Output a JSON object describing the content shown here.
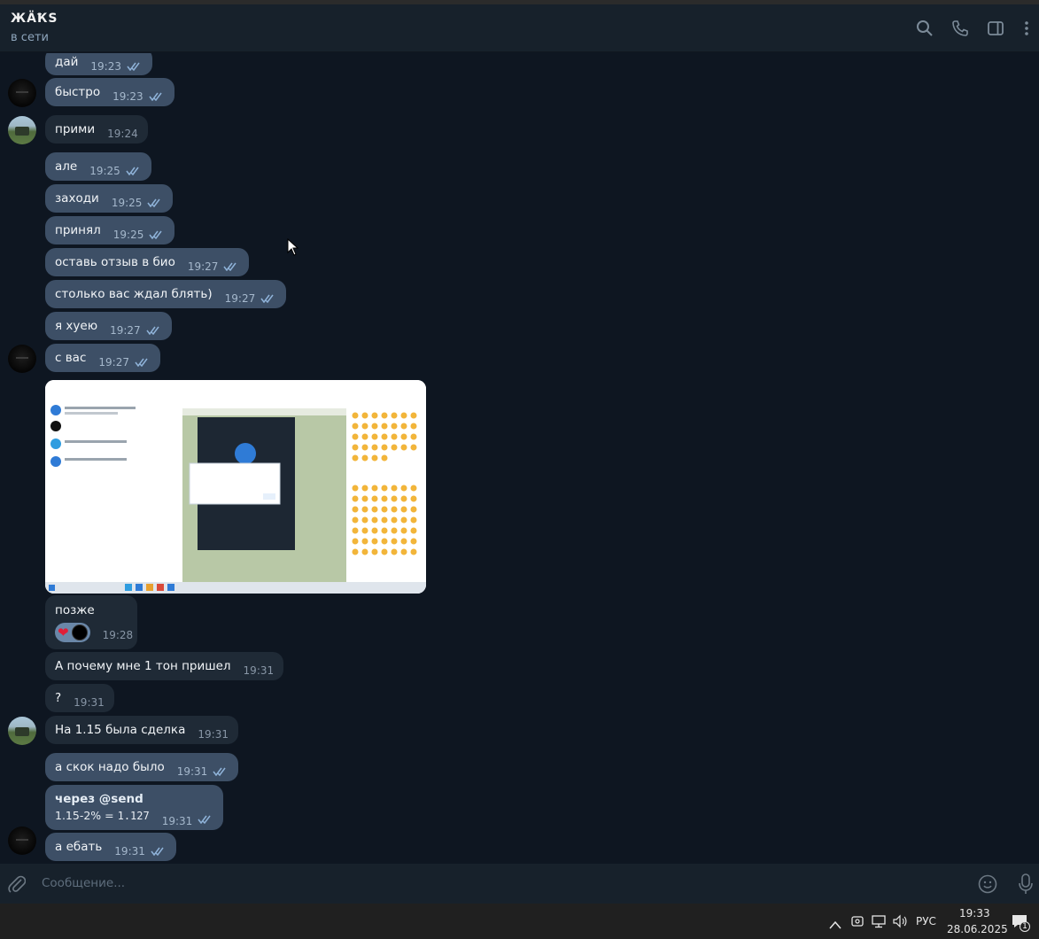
{
  "header": {
    "title": "ЖÄҞS",
    "status": "в сети"
  },
  "messages": [
    {
      "dir": "out",
      "text": "дай",
      "time": "19:23"
    },
    {
      "dir": "out",
      "text": "быстро",
      "time": "19:23"
    },
    {
      "dir": "in",
      "text": "прими",
      "time": "19:24"
    },
    {
      "dir": "out",
      "text": "але",
      "time": "19:25"
    },
    {
      "dir": "out",
      "text": "заходи",
      "time": "19:25"
    },
    {
      "dir": "out",
      "text": "принял",
      "time": "19:25"
    },
    {
      "dir": "out",
      "text": "оставь отзыв в био",
      "time": "19:27"
    },
    {
      "dir": "out",
      "text": "столько вас ждал блять)",
      "time": "19:27"
    },
    {
      "dir": "out",
      "text": "я хуею",
      "time": "19:27"
    },
    {
      "dir": "out",
      "text": "с вас",
      "time": "19:27"
    },
    {
      "dir": "in",
      "text": "позже",
      "time": "19:28"
    },
    {
      "dir": "in",
      "text": "А почему мне 1 тон пришел",
      "time": "19:31"
    },
    {
      "dir": "in",
      "text": "?",
      "time": "19:31"
    },
    {
      "dir": "in",
      "text": "На 1.15 была сделка",
      "time": "19:31"
    },
    {
      "dir": "out",
      "text": "а скок надо было",
      "time": "19:31"
    },
    {
      "dir": "out",
      "line1": "через @send",
      "line2a": "1.15-2% = ",
      "line2b": "1.127",
      "time": "19:31"
    },
    {
      "dir": "out",
      "text": "а ебать",
      "time": "19:31"
    }
  ],
  "composer": {
    "placeholder": "Сообщение..."
  },
  "taskbar": {
    "lang": "РУС",
    "clock": "19:33",
    "date": "28.06.2025",
    "notif_count": "1"
  },
  "colors": {
    "chat_bg": "#0e1621",
    "header_bg": "#17212b",
    "bubble_out": "#3d4f66",
    "bubble_in": "#1f2a36"
  }
}
